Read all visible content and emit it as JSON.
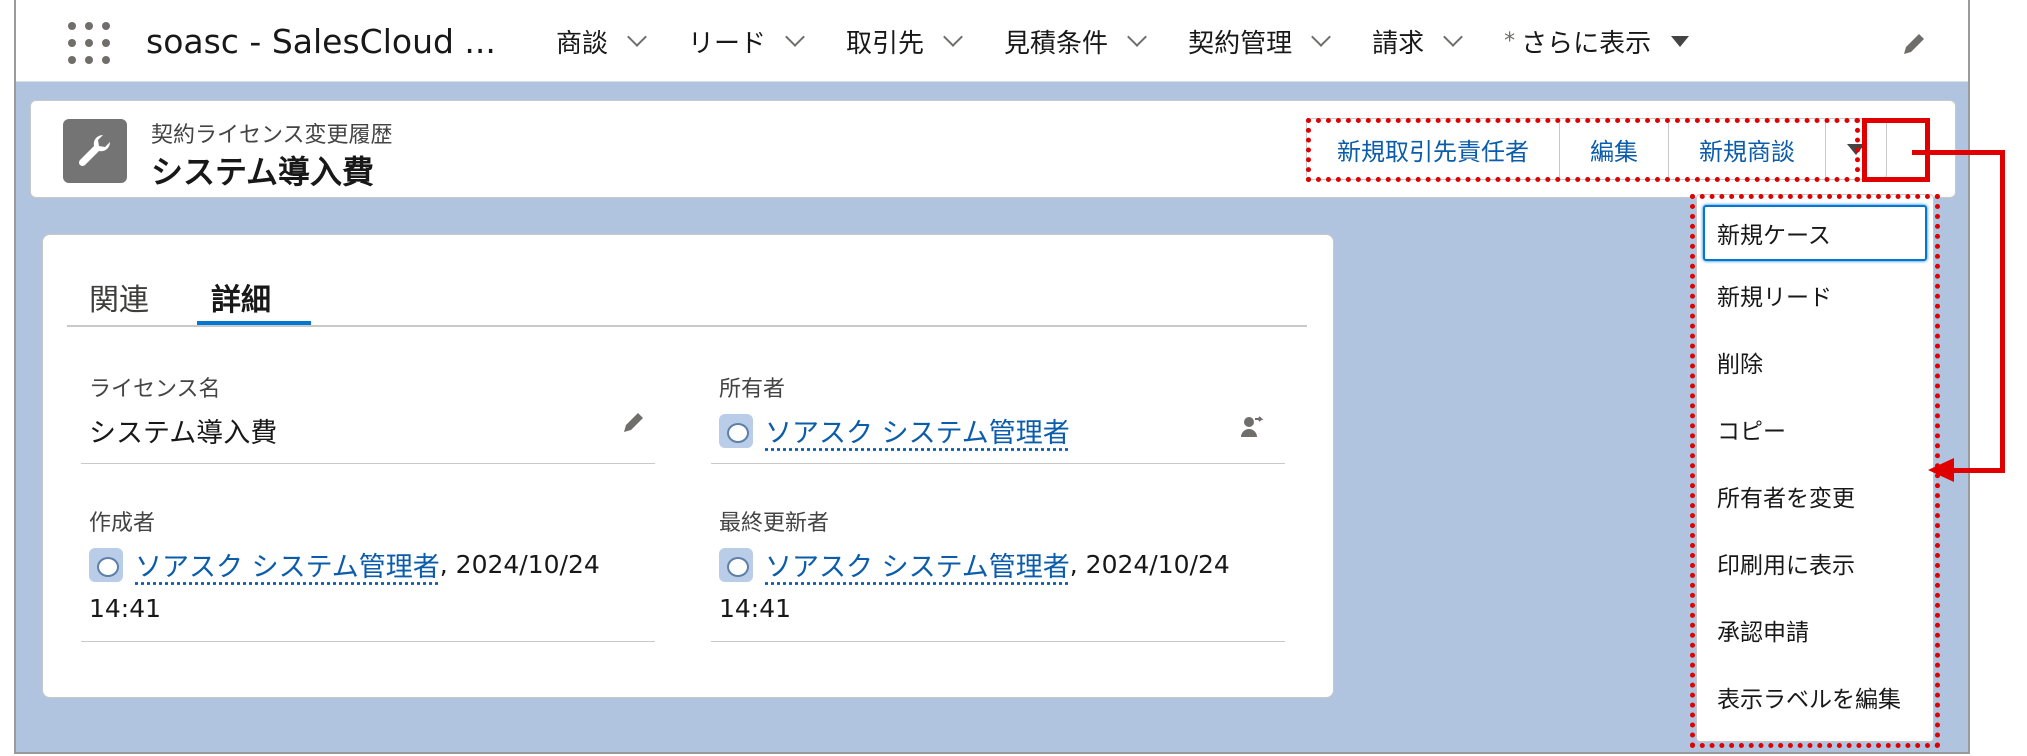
{
  "app": {
    "name": "soasc - SalesCloud ..."
  },
  "nav": {
    "items": [
      {
        "label": "商談"
      },
      {
        "label": "リード"
      },
      {
        "label": "取引先"
      },
      {
        "label": "見積条件"
      },
      {
        "label": "契約管理"
      },
      {
        "label": "請求"
      }
    ],
    "more": {
      "star": "*",
      "label": "さらに表示"
    }
  },
  "header": {
    "object_label": "契約ライセンス変更履歴",
    "record_title": "システム導入費",
    "icon": "wrench-icon",
    "actions": [
      "新規取引先責任者",
      "編集",
      "新規商談"
    ]
  },
  "tabs": {
    "related": "関連",
    "details": "詳細"
  },
  "fields": {
    "license_name": {
      "label": "ライセンス名",
      "value": "システム導入費"
    },
    "owner": {
      "label": "所有者",
      "value": "ソアスク システム管理者"
    },
    "created_by": {
      "label": "作成者",
      "user": "ソアスク システム管理者",
      "date": ", 2024/10/24",
      "time": "14:41"
    },
    "modified_by": {
      "label": "最終更新者",
      "user": "ソアスク システム管理者",
      "date": ", 2024/10/24",
      "time": "14:41"
    }
  },
  "menu": {
    "items": [
      "新規ケース",
      "新規リード",
      "削除",
      "コピー",
      "所有者を変更",
      "印刷用に表示",
      "承認申請",
      "表示ラベルを編集"
    ]
  },
  "colors": {
    "annotation": "#e00000",
    "link": "#0b5cab",
    "accent": "#0176d3"
  }
}
